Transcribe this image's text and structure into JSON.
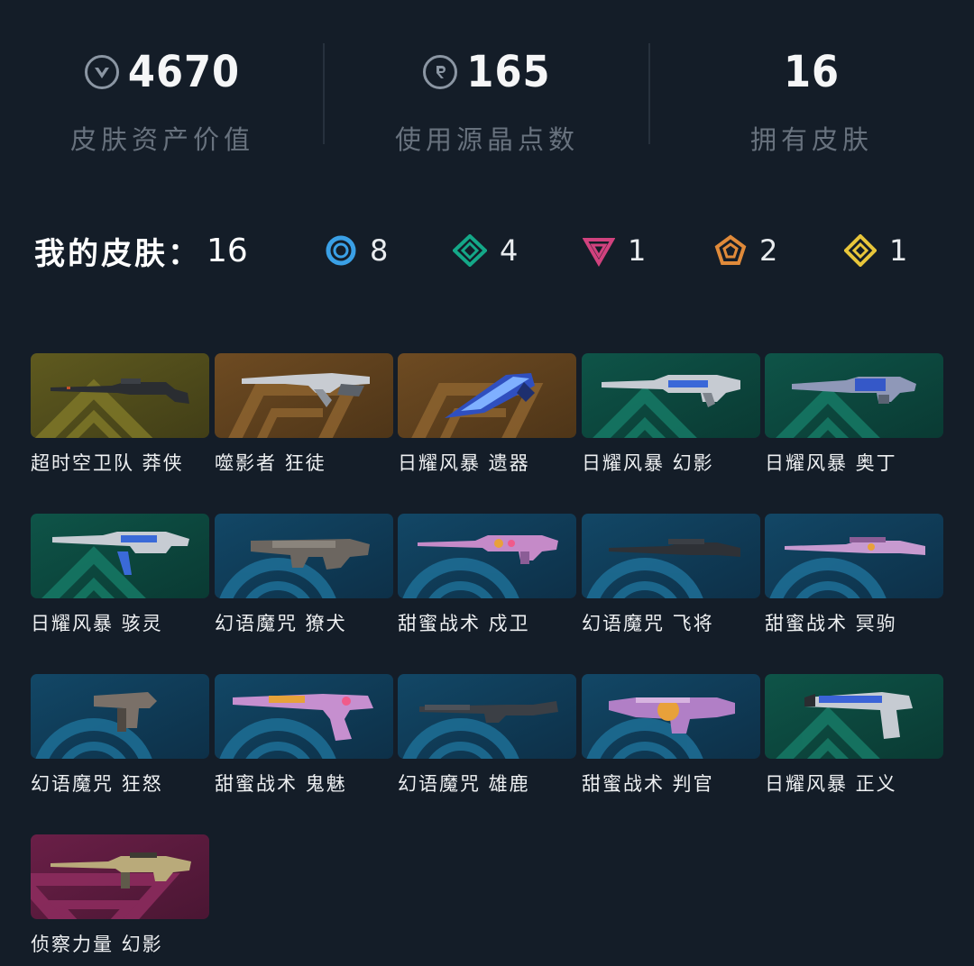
{
  "stats": [
    {
      "icon": "valorant-points-icon",
      "value": "4670",
      "label": "皮肤资产价值"
    },
    {
      "icon": "radianite-points-icon",
      "value": "165",
      "label": "使用源晶点数"
    },
    {
      "icon": "",
      "value": "16",
      "label": "拥有皮肤"
    }
  ],
  "summary": {
    "label": "我的皮肤：",
    "total": "16",
    "tiers": [
      {
        "icon": "select-tier-icon",
        "color": "#3aa0e6",
        "count": "8"
      },
      {
        "icon": "deluxe-tier-icon",
        "color": "#14a888",
        "count": "4"
      },
      {
        "icon": "premium-tier-icon",
        "color": "#d1427e",
        "count": "1"
      },
      {
        "icon": "ultra-tier-icon",
        "color": "#e08a3a",
        "count": "2"
      },
      {
        "icon": "exclusive-tier-icon",
        "color": "#e8c63a",
        "count": "1"
      }
    ]
  },
  "skins": [
    {
      "name": "超时空卫队 莽侠",
      "tier": "exclusive",
      "gun": "rifle-long"
    },
    {
      "name": "噬影者 狂徒",
      "tier": "ultra",
      "gun": "rifle-sleek"
    },
    {
      "name": "日耀风暴 遗器",
      "tier": "ultra",
      "gun": "blade"
    },
    {
      "name": "日耀风暴 幻影",
      "tier": "deluxe",
      "gun": "rifle"
    },
    {
      "name": "日耀风暴 奥丁",
      "tier": "deluxe",
      "gun": "lmg"
    },
    {
      "name": "日耀风暴 骇灵",
      "tier": "deluxe",
      "gun": "smg"
    },
    {
      "name": "幻语魔咒 獠犬",
      "tier": "select",
      "gun": "bulldog"
    },
    {
      "name": "甜蜜战术 戍卫",
      "tier": "select",
      "gun": "rifle-pink"
    },
    {
      "name": "幻语魔咒 飞将",
      "tier": "select",
      "gun": "sniper"
    },
    {
      "name": "甜蜜战术 冥驹",
      "tier": "select",
      "gun": "sniper-pink"
    },
    {
      "name": "幻语魔咒 狂怒",
      "tier": "select",
      "gun": "pistol-mp"
    },
    {
      "name": "甜蜜战术 鬼魅",
      "tier": "select",
      "gun": "pistol-pink"
    },
    {
      "name": "幻语魔咒 雄鹿",
      "tier": "select",
      "gun": "shotgun"
    },
    {
      "name": "甜蜜战术 判官",
      "tier": "select",
      "gun": "judge-pink"
    },
    {
      "name": "日耀风暴 正义",
      "tier": "deluxe",
      "gun": "pistol"
    },
    {
      "name": "侦察力量 幻影",
      "tier": "premium",
      "gun": "rifle-tan"
    }
  ]
}
